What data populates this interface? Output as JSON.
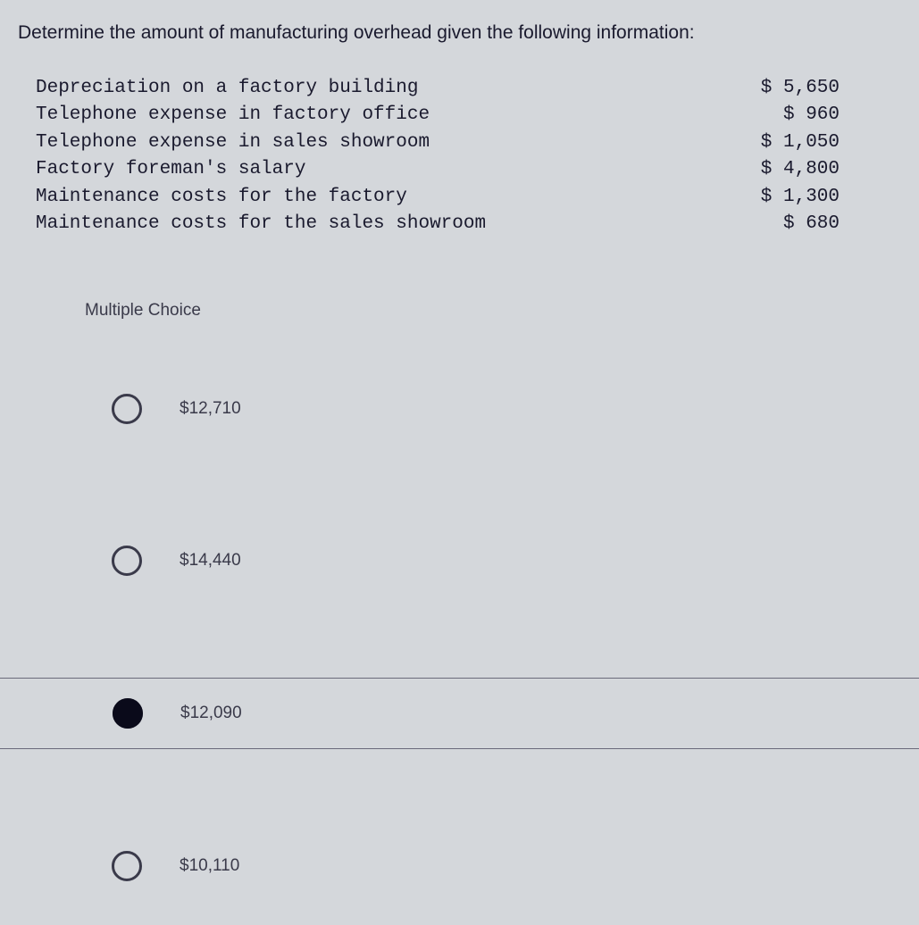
{
  "question": "Determine the amount of manufacturing overhead given the following information:",
  "items": [
    {
      "desc": "Depreciation on a factory building",
      "amount": "$ 5,650"
    },
    {
      "desc": "Telephone expense in factory office",
      "amount": "$ 960"
    },
    {
      "desc": "Telephone expense in sales showroom",
      "amount": "$ 1,050"
    },
    {
      "desc": "Factory foreman's salary",
      "amount": "$ 4,800"
    },
    {
      "desc": "Maintenance costs for the factory",
      "amount": "$ 1,300"
    },
    {
      "desc": "Maintenance costs for the sales showroom",
      "amount": "$ 680"
    }
  ],
  "mc_label": "Multiple Choice",
  "choices": [
    {
      "label": "$12,710",
      "selected": false
    },
    {
      "label": "$14,440",
      "selected": false
    },
    {
      "label": "$12,090",
      "selected": true
    },
    {
      "label": "$10,110",
      "selected": false
    }
  ]
}
